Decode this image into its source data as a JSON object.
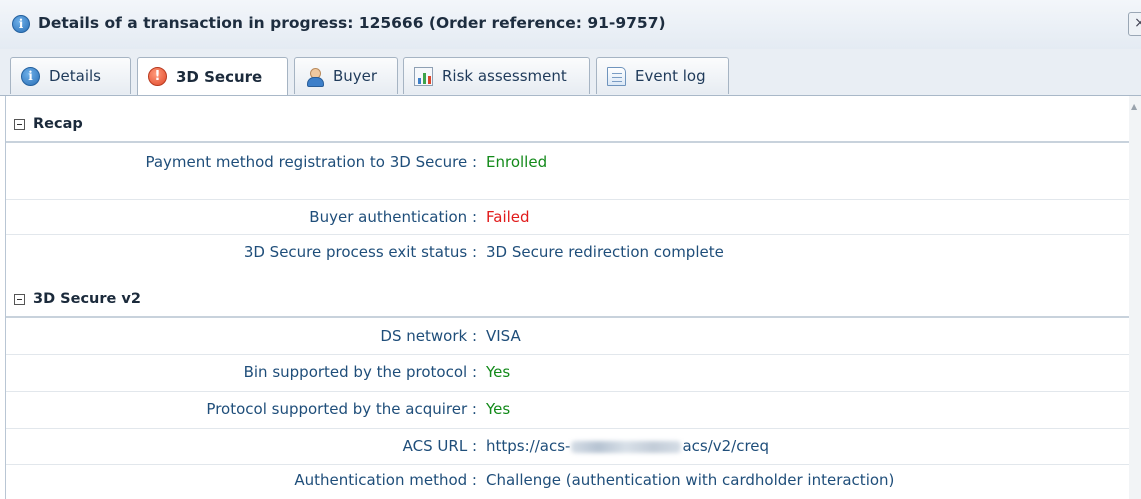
{
  "window": {
    "title": "Details of a transaction in progress: 125666 (Order reference: 91-9757)",
    "close_label": "×"
  },
  "tabs": [
    {
      "label": "Details",
      "icon": "info-icon",
      "active": false
    },
    {
      "label": "3D Secure",
      "icon": "warning-icon",
      "active": true
    },
    {
      "label": "Buyer",
      "icon": "user-icon",
      "active": false
    },
    {
      "label": "Risk assessment",
      "icon": "chart-icon",
      "active": false
    },
    {
      "label": "Event log",
      "icon": "log-icon",
      "active": false
    }
  ],
  "recap": {
    "title": "Recap",
    "rows": [
      {
        "label": "Payment method registration to 3D Secure :",
        "value": "Enrolled",
        "status": "green"
      },
      {
        "label": "Buyer authentication :",
        "value": "Failed",
        "status": "red"
      },
      {
        "label": "3D Secure process exit status :",
        "value": "3D Secure redirection complete",
        "status": "normal"
      }
    ]
  },
  "v2": {
    "title": "3D Secure v2",
    "rows": [
      {
        "label": "DS network :",
        "value": "VISA",
        "status": "normal"
      },
      {
        "label": "Bin supported by the protocol :",
        "value": "Yes",
        "status": "green"
      },
      {
        "label": "Protocol supported by the acquirer :",
        "value": "Yes",
        "status": "green"
      },
      {
        "label": "ACS URL :",
        "value_prefix": "https://acs-",
        "value_suffix": "acs/v2/creq",
        "status": "normal"
      },
      {
        "label": "Authentication method :",
        "value": "Challenge (authentication with cardholder interaction)",
        "status": "normal"
      }
    ]
  },
  "colors": {
    "green": "#138a1a",
    "red": "#e11b1b",
    "text": "#1f4e7a"
  }
}
